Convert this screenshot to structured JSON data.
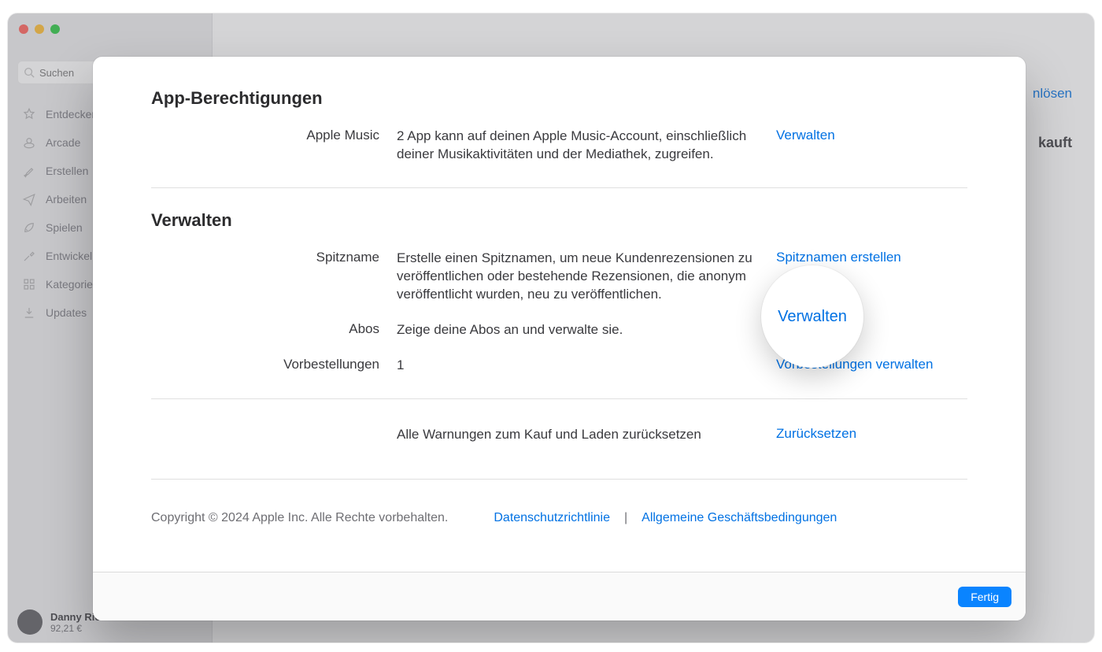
{
  "search": {
    "placeholder": "Suchen"
  },
  "sidebar": {
    "items": [
      {
        "label": "Entdecken",
        "icon": "star-icon"
      },
      {
        "label": "Arcade",
        "icon": "arcade-icon"
      },
      {
        "label": "Erstellen",
        "icon": "brush-icon"
      },
      {
        "label": "Arbeiten",
        "icon": "paperplane-icon"
      },
      {
        "label": "Spielen",
        "icon": "rocket-icon"
      },
      {
        "label": "Entwickeln",
        "icon": "hammer-icon"
      },
      {
        "label": "Kategorien",
        "icon": "grid-icon"
      },
      {
        "label": "Updates",
        "icon": "download-icon"
      }
    ]
  },
  "user": {
    "name": "Danny Rico",
    "balance": "92,21 €"
  },
  "background": {
    "top_link_fragment": "nlösen",
    "bold_fragment": "kauft"
  },
  "sheet": {
    "sections": {
      "permissions": {
        "title": "App-Berechtigungen",
        "rows": {
          "apple_music": {
            "label": "Apple Music",
            "desc": "2 App kann auf deinen Apple Music-Account, einschließlich deiner Musikaktivitäten und der Mediathek, zugreifen.",
            "action": "Verwalten"
          }
        }
      },
      "manage": {
        "title": "Verwalten",
        "rows": {
          "nickname": {
            "label": "Spitzname",
            "desc": "Erstelle einen Spitznamen, um neue Kundenrezensionen zu veröffentlichen oder bestehende Rezensionen, die anonym veröffentlicht wurden, neu zu veröffentlichen.",
            "action": "Spitznamen erstellen"
          },
          "subs": {
            "label": "Abos",
            "desc": "Zeige deine Abos an und verwalte sie.",
            "action": "Verwalten"
          },
          "preorders": {
            "label": "Vorbestellungen",
            "desc": "1",
            "action": "Vorbestellungen verwalten"
          }
        }
      },
      "reset": {
        "rows": {
          "reset_warnings": {
            "label": "",
            "desc": "Alle Warnungen zum Kauf und Laden zurücksetzen",
            "action": "Zurücksetzen"
          }
        }
      }
    },
    "footer": {
      "copyright": "Copyright © 2024 Apple Inc. Alle Rechte vorbehalten.",
      "privacy": "Datenschutzrichtlinie",
      "separator": "|",
      "terms": "Allgemeine Geschäftsbedingungen"
    },
    "done_button": "Fertig"
  },
  "lens": {
    "label": "Verwalten"
  }
}
